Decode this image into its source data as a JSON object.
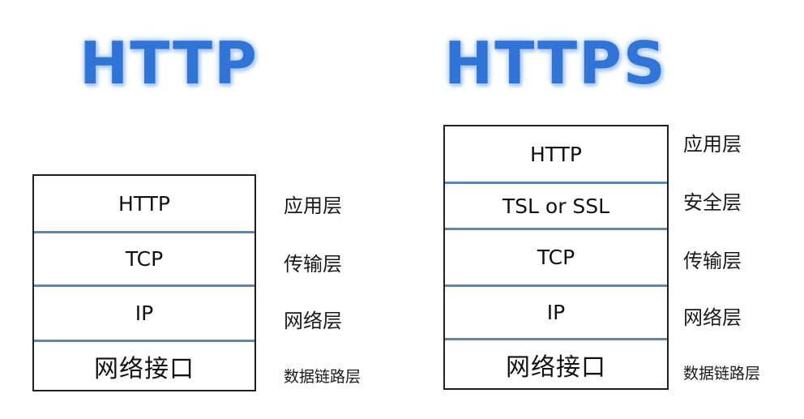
{
  "titles": {
    "http": "HTTP",
    "https": "HTTPS"
  },
  "http_stack": {
    "layers": [
      "HTTP",
      "TCP",
      "IP",
      "网络接口"
    ],
    "labels": [
      "应用层",
      "传输层",
      "网络层",
      "数据链路层"
    ]
  },
  "https_stack": {
    "layers": [
      "HTTP",
      "TSL or SSL",
      "TCP",
      "IP",
      "网络接口"
    ],
    "labels": [
      "应用层",
      "安全层",
      "传输层",
      "网络层",
      "数据链路层"
    ]
  },
  "colors": {
    "title_blue": "#2f74d6",
    "divider_blue": "#5b87b4",
    "border": "#1f1f1f"
  }
}
